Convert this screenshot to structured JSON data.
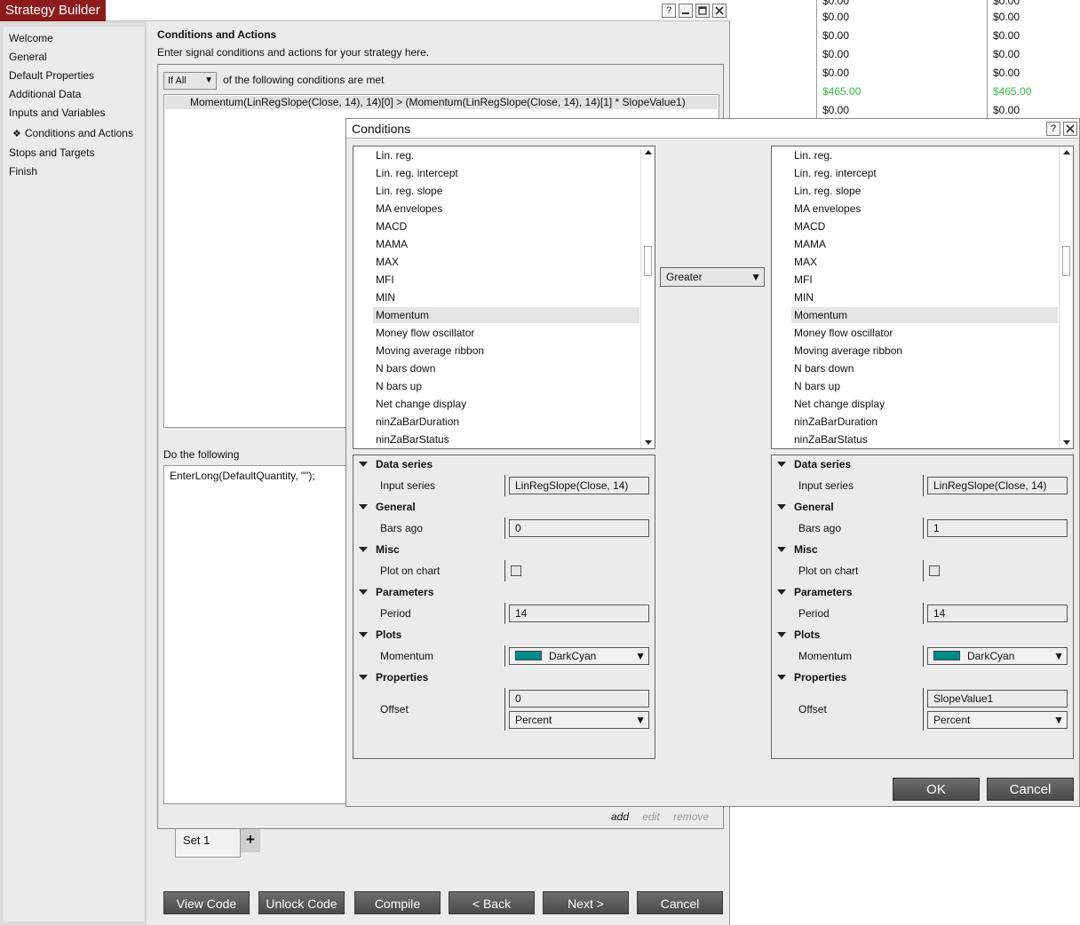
{
  "background_grid": {
    "col1": [
      "$0.00",
      "$0.00",
      "$0.00",
      "$0.00",
      "$465.00",
      "$0.00"
    ],
    "col2": [
      "$0.00",
      "$0.00",
      "$0.00",
      "$0.00",
      "$465.00",
      "$0.00"
    ],
    "positive_color": "#39b54a"
  },
  "window": {
    "title": "Strategy Builder",
    "title_buttons": {
      "help": "?",
      "minimize": "—",
      "maximize": "□",
      "close": "×"
    }
  },
  "sidebar": {
    "items": [
      {
        "label": "Welcome"
      },
      {
        "label": "General"
      },
      {
        "label": "Default Properties"
      },
      {
        "label": "Additional Data"
      },
      {
        "label": "Inputs and Variables"
      },
      {
        "label": "Conditions and Actions",
        "bullet": "❖"
      },
      {
        "label": "Stops and Targets"
      },
      {
        "label": "Finish"
      }
    ]
  },
  "content": {
    "heading": "Conditions and Actions",
    "subheading": "Enter signal conditions and actions for your strategy here.",
    "condition_mode": "If All",
    "condition_lead": "of the following conditions are met",
    "conditions": [
      "Momentum(LinRegSlope(Close, 14), 14)[0] > (Momentum(LinRegSlope(Close, 14), 14)[1] * SlopeValue1)"
    ],
    "actions_label": "Do the following",
    "actions": [
      "EnterLong(DefaultQuantity, \"\");"
    ],
    "links": {
      "add": "add",
      "edit": "edit",
      "remove": "remove"
    },
    "set_tab": "Set 1",
    "add_set": "+"
  },
  "bottom_buttons": {
    "view_code": "View Code",
    "unlock_code": "Unlock Code",
    "compile": "Compile",
    "back": "< Back",
    "next": "Next >",
    "cancel": "Cancel"
  },
  "dialog": {
    "title": "Conditions",
    "title_buttons": {
      "help": "?",
      "close": "×"
    },
    "indicators": [
      "Lin. reg.",
      "Lin. reg. intercept",
      "Lin. reg. slope",
      "MA envelopes",
      "MACD",
      "MAMA",
      "MAX",
      "MFI",
      "MIN",
      "Momentum",
      "Money flow oscillator",
      "Moving average ribbon",
      "N bars down",
      "N bars up",
      "Net change display",
      "ninZaBarDuration",
      "ninZaBarStatus"
    ],
    "selected_indicator": "Momentum",
    "operator": "Greater",
    "left": {
      "categories": {
        "data_series": "Data series",
        "general": "General",
        "misc": "Misc",
        "parameters": "Parameters",
        "plots": "Plots",
        "properties": "Properties"
      },
      "labels": {
        "input_series": "Input series",
        "bars_ago": "Bars ago",
        "plot_on_chart": "Plot on chart",
        "period": "Period",
        "momentum": "Momentum",
        "offset": "Offset"
      },
      "values": {
        "input_series": "LinRegSlope(Close, 14)",
        "bars_ago": "0",
        "period": "14",
        "plot_color": "DarkCyan",
        "offset": "0",
        "offset_type": "Percent"
      }
    },
    "right": {
      "categories": {
        "data_series": "Data series",
        "general": "General",
        "misc": "Misc",
        "parameters": "Parameters",
        "plots": "Plots",
        "properties": "Properties"
      },
      "labels": {
        "input_series": "Input series",
        "bars_ago": "Bars ago",
        "plot_on_chart": "Plot on chart",
        "period": "Period",
        "momentum": "Momentum",
        "offset": "Offset"
      },
      "values": {
        "input_series": "LinRegSlope(Close, 14)",
        "bars_ago": "1",
        "period": "14",
        "plot_color": "DarkCyan",
        "offset": "SlopeValue1",
        "offset_type": "Percent"
      }
    },
    "ok": "OK",
    "cancel": "Cancel"
  },
  "colors": {
    "title_accent": "#8e1b1b",
    "plot_swatch": "#008b8b",
    "button_dark": "#5a5a5a"
  }
}
